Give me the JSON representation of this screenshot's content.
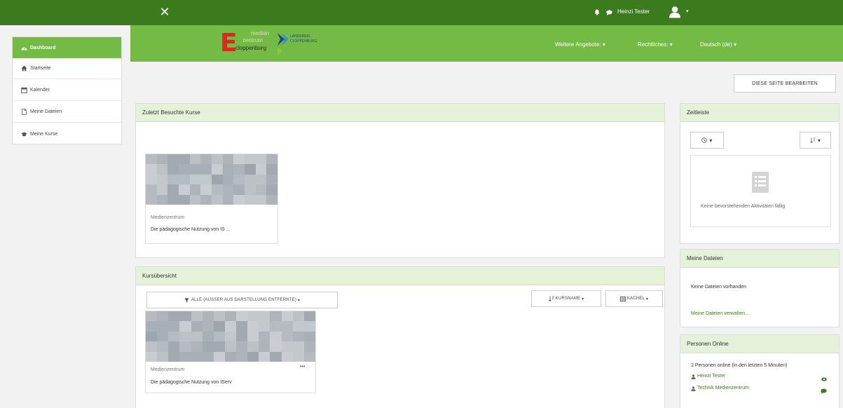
{
  "topbar": {
    "close_glyph": "✕",
    "user_name": "Heinzi Tester",
    "caret": "▾",
    "icons": [
      "bell-icon",
      "chat-icon",
      "user-avatar-icon"
    ]
  },
  "header": {
    "logo": {
      "letter": "E",
      "line1": "medien",
      "line2": "zentrum",
      "line3": "cloppenburg",
      "right1": "LANDKREIS",
      "right2": "CLOPPENBURG"
    },
    "nav": [
      {
        "label": "Weitere Angebote:"
      },
      {
        "label": "Rechtliches:"
      },
      {
        "label": "Deutsch (de)"
      }
    ]
  },
  "sidebar": {
    "items": [
      {
        "label": "Dashboard",
        "icon": "dashboard-icon",
        "active": true
      },
      {
        "label": "Startseite",
        "icon": "home-icon"
      },
      {
        "label": "Kalender",
        "icon": "calendar-icon"
      },
      {
        "label": "Meine Dateien",
        "icon": "file-icon"
      },
      {
        "label": "Meine Kurse",
        "icon": "graduation-cap-icon"
      }
    ]
  },
  "edit_button": "DIESE SEITE BEARBEITEN",
  "recent": {
    "title": "Zuletzt Besuchte Kurse",
    "course": {
      "category": "Medienzentrum",
      "name": "Die pädagogische Nutzung von IS ..."
    }
  },
  "overview": {
    "title": "Kursübersicht",
    "filter_button": "ALLE (AUSSER AUS DARSTELLUNG ENTFERNTE)",
    "sort_button": "KURSNAME",
    "view_button": "KACHEL",
    "course": {
      "category": "Medienzentrum",
      "name": "Die pädagogische Nutzung von IServ",
      "menu": "•••"
    }
  },
  "timeline": {
    "title": "Zeitleiste",
    "empty_text": "Keine bevorstehenden Aktivitäten fällig"
  },
  "files": {
    "title": "Meine Dateien",
    "empty_text": "Keine Dateien vorhanden",
    "manage_link": "Meine Dateien verwalten..."
  },
  "online": {
    "title": "Personen Online",
    "summary": "2 Personen online (in den letzten 5 Minuten)",
    "users": [
      {
        "name": "Heinzi Tester"
      },
      {
        "name": "Technik Medienzentrum"
      }
    ]
  },
  "colors": {
    "topbar": "#3c7a1e",
    "header": "#73bb44",
    "card_header": "#e5f2d9",
    "logo_red": "#e52421"
  }
}
